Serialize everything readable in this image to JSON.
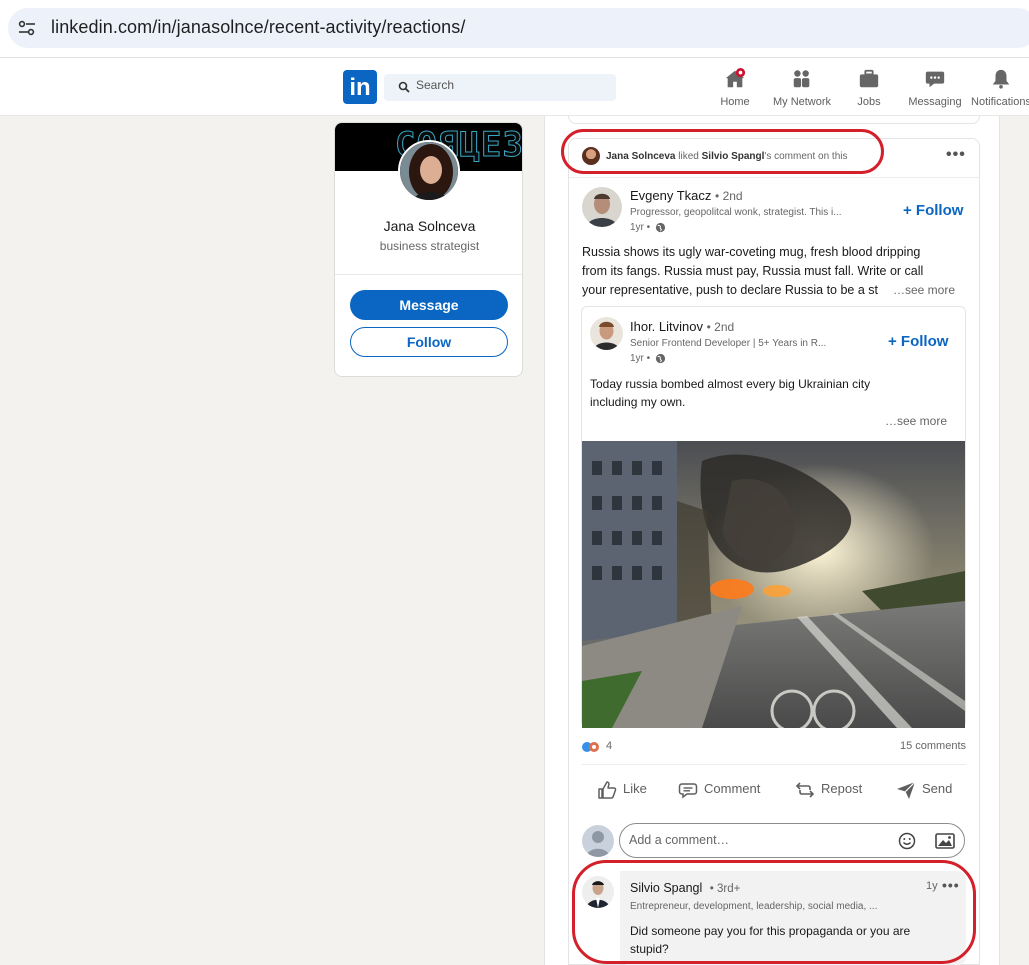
{
  "browser": {
    "url": "linkedin.com/in/janasolnce/recent-activity/reactions/"
  },
  "nav": {
    "logo": "in",
    "search_placeholder": "Search",
    "items": [
      {
        "label": "Home",
        "icon": "home-icon"
      },
      {
        "label": "My Network",
        "icon": "network-icon"
      },
      {
        "label": "Jobs",
        "icon": "briefcase-icon"
      },
      {
        "label": "Messaging",
        "icon": "messaging-icon"
      },
      {
        "label": "Notifications",
        "icon": "bell-icon"
      }
    ]
  },
  "profile": {
    "banner_text": "СОЯЦЕЗ",
    "name": "Jana Solnceva",
    "headline": "business strategist",
    "message_label": "Message",
    "follow_label": "Follow"
  },
  "activity": {
    "actor": "Jana Solnceva",
    "verb": "liked",
    "target": "Silvio Spangl",
    "suffix": "'s comment on this"
  },
  "post": {
    "author": {
      "name": "Evgeny Tkacz",
      "degree": "• 2nd",
      "headline": "Progressor, geopolitcal wonk, strategist. This i...",
      "time": "1yr •"
    },
    "follow_label": "+ Follow",
    "text_lines": [
      "Russia shows its ugly war-coveting mug, fresh blood dripping",
      "from its fangs. Russia must pay, Russia must fall. Write or call",
      "your representative, push to declare Russia to be a st"
    ],
    "see_more": "…see more",
    "shared": {
      "author": {
        "name": "Ihor. Litvinov",
        "degree": "• 2nd",
        "headline": "Senior Frontend Developer | 5+ Years in R...",
        "time": "1yr •"
      },
      "follow_label": "+ Follow",
      "text_lines": [
        "Today russia bombed almost every big Ukrainian city",
        "including my own."
      ],
      "see_more": "…see more"
    },
    "reaction_count": "4",
    "comments_count": "15 comments",
    "actions": [
      {
        "label": "Like",
        "icon": "like-icon"
      },
      {
        "label": "Comment",
        "icon": "comment-icon"
      },
      {
        "label": "Repost",
        "icon": "repost-icon"
      },
      {
        "label": "Send",
        "icon": "send-icon"
      }
    ],
    "comment_placeholder": "Add a comment…",
    "comment": {
      "author": "Silvio Spangl",
      "degree": "• 3rd+",
      "headline": "Entrepreneur, development, leadership, social media, ...",
      "time": "1y",
      "text_lines": [
        "Did someone pay you for this propaganda or you are",
        "stupid?"
      ]
    }
  },
  "colors": {
    "brand": "#0a66c2",
    "annotation": "#d4202a",
    "notification_badge": "#cb112d"
  }
}
